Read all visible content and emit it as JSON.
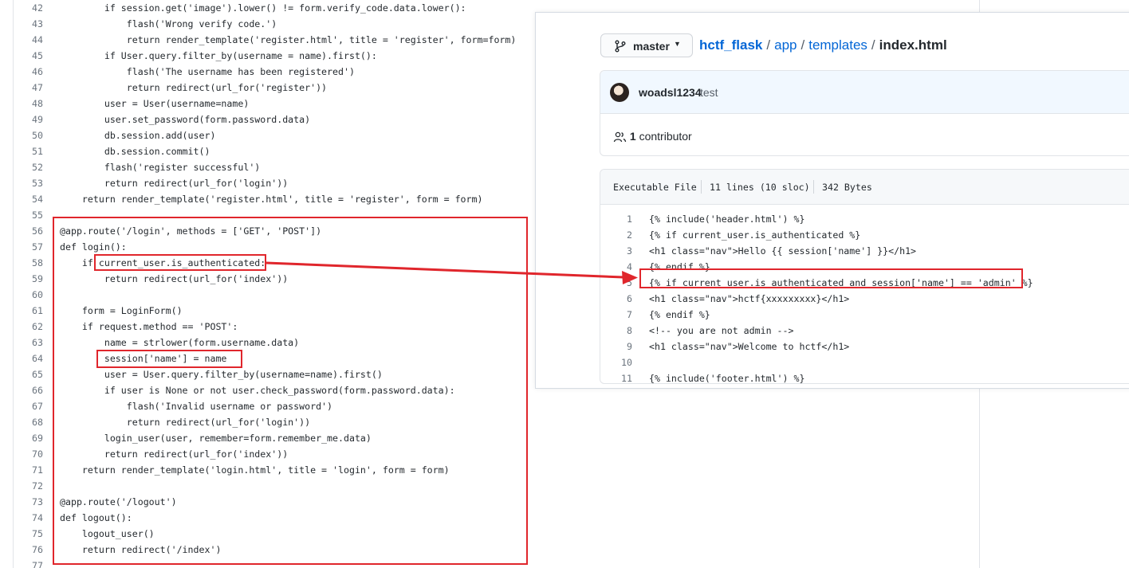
{
  "left_code": {
    "lines": [
      {
        "n": "42",
        "code": "        if session.get('image').lower() != form.verify_code.data.lower():"
      },
      {
        "n": "43",
        "code": "            flash('Wrong verify code.')"
      },
      {
        "n": "44",
        "code": "            return render_template('register.html', title = 'register', form=form)"
      },
      {
        "n": "45",
        "code": "        if User.query.filter_by(username = name).first():"
      },
      {
        "n": "46",
        "code": "            flash('The username has been registered')"
      },
      {
        "n": "47",
        "code": "            return redirect(url_for('register'))"
      },
      {
        "n": "48",
        "code": "        user = User(username=name)"
      },
      {
        "n": "49",
        "code": "        user.set_password(form.password.data)"
      },
      {
        "n": "50",
        "code": "        db.session.add(user)"
      },
      {
        "n": "51",
        "code": "        db.session.commit()"
      },
      {
        "n": "52",
        "code": "        flash('register successful')"
      },
      {
        "n": "53",
        "code": "        return redirect(url_for('login'))"
      },
      {
        "n": "54",
        "code": "    return render_template('register.html', title = 'register', form = form)"
      },
      {
        "n": "55",
        "code": ""
      },
      {
        "n": "56",
        "code": "@app.route('/login', methods = ['GET', 'POST'])"
      },
      {
        "n": "57",
        "code": "def login():"
      },
      {
        "n": "58",
        "code": "    if current_user.is_authenticated:"
      },
      {
        "n": "59",
        "code": "        return redirect(url_for('index'))"
      },
      {
        "n": "60",
        "code": ""
      },
      {
        "n": "61",
        "code": "    form = LoginForm()"
      },
      {
        "n": "62",
        "code": "    if request.method == 'POST':"
      },
      {
        "n": "63",
        "code": "        name = strlower(form.username.data)"
      },
      {
        "n": "64",
        "code": "        session['name'] = name"
      },
      {
        "n": "65",
        "code": "        user = User.query.filter_by(username=name).first()"
      },
      {
        "n": "66",
        "code": "        if user is None or not user.check_password(form.password.data):"
      },
      {
        "n": "67",
        "code": "            flash('Invalid username or password')"
      },
      {
        "n": "68",
        "code": "            return redirect(url_for('login'))"
      },
      {
        "n": "69",
        "code": "        login_user(user, remember=form.remember_me.data)"
      },
      {
        "n": "70",
        "code": "        return redirect(url_for('index'))"
      },
      {
        "n": "71",
        "code": "    return render_template('login.html', title = 'login', form = form)"
      },
      {
        "n": "72",
        "code": ""
      },
      {
        "n": "73",
        "code": "@app.route('/logout')"
      },
      {
        "n": "74",
        "code": "def logout():"
      },
      {
        "n": "75",
        "code": "    logout_user()"
      },
      {
        "n": "76",
        "code": "    return redirect('/index')"
      },
      {
        "n": "77",
        "code": ""
      }
    ]
  },
  "github": {
    "branch": "master",
    "breadcrumb": {
      "repo": "hctf_flask",
      "dir1": "app",
      "dir2": "templates",
      "file": "index.html",
      "sep": "/"
    },
    "commit": {
      "author": "woadsl1234",
      "message": "test"
    },
    "contributors": {
      "count": "1",
      "label": "contributor"
    },
    "file_info": {
      "mode": "Executable File",
      "lines": "11 lines (10 sloc)",
      "size": "342 Bytes"
    },
    "lines": [
      {
        "n": "1",
        "code": "{% include('header.html') %}"
      },
      {
        "n": "2",
        "code": "{% if current_user.is_authenticated %}"
      },
      {
        "n": "3",
        "code": "<h1 class=\"nav\">Hello {{ session['name'] }}</h1>"
      },
      {
        "n": "4",
        "code": "{% endif %}"
      },
      {
        "n": "5",
        "code": "{% if current_user.is_authenticated and session['name'] == 'admin' %}"
      },
      {
        "n": "6",
        "code": "<h1 class=\"nav\">hctf{xxxxxxxxx}</h1>"
      },
      {
        "n": "7",
        "code": "{% endif %}"
      },
      {
        "n": "8",
        "code": "<!-- you are not admin -->"
      },
      {
        "n": "9",
        "code": "<h1 class=\"nav\">Welcome to hctf</h1>"
      },
      {
        "n": "10",
        "code": ""
      },
      {
        "n": "11",
        "code": "{% include('footer.html') %}"
      }
    ]
  },
  "colors": {
    "annotation_red": "#e0262c",
    "link_blue": "#0366d6"
  },
  "icons": [
    "git-branch-icon",
    "caret-down-icon",
    "people-icon",
    "avatar"
  ]
}
